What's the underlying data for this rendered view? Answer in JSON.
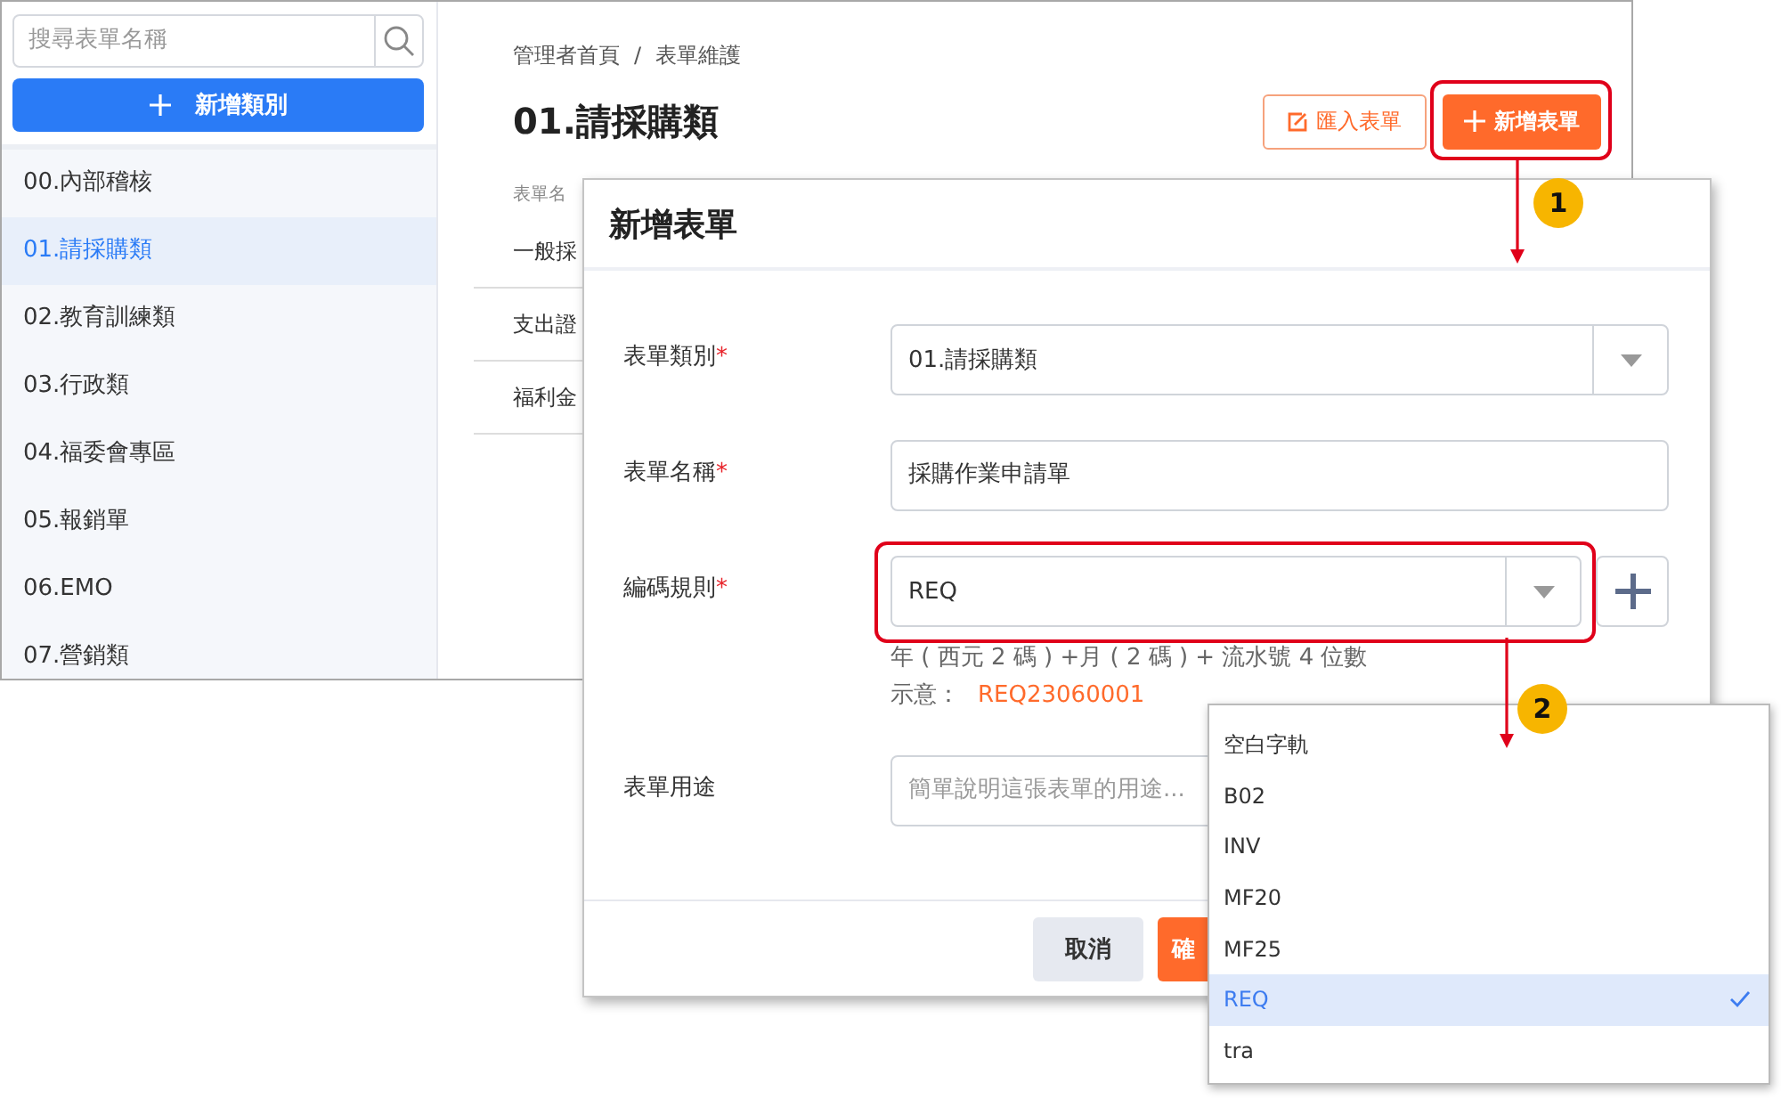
{
  "sidebar": {
    "search": {
      "placeholder": "搜尋表單名稱"
    },
    "add_button": "新增類別",
    "items": [
      {
        "label": "00.內部稽核",
        "selected": false
      },
      {
        "label": "01.請採購類",
        "selected": true
      },
      {
        "label": "02.教育訓練類",
        "selected": false
      },
      {
        "label": "03.行政類",
        "selected": false
      },
      {
        "label": "04.福委會專區",
        "selected": false
      },
      {
        "label": "05.報銷單",
        "selected": false
      },
      {
        "label": "06.EMO",
        "selected": false
      },
      {
        "label": "07.營銷類",
        "selected": false
      }
    ]
  },
  "breadcrumb": [
    "管理者首頁",
    "表單維護"
  ],
  "breadcrumb_separator": "/",
  "page_title": "01.請採購類",
  "actions": [
    {
      "label": "匯入表單",
      "kind": "outline"
    },
    {
      "label": "新增表單",
      "kind": "primary"
    }
  ],
  "table": {
    "columns": [
      "表單名"
    ],
    "rows": [
      "一般採",
      "支出證",
      "福利金"
    ]
  },
  "dialog": {
    "title": "新增表單",
    "required_mark": "*",
    "fields": [
      {
        "label": "表單類別",
        "required": true,
        "kind": "select",
        "value": "01.請採購類"
      },
      {
        "label": "表單名稱",
        "required": true,
        "kind": "text",
        "value": "採購作業申請單"
      },
      {
        "label": "編碼規則",
        "required": true,
        "kind": "select-add",
        "value": "REQ",
        "hint": "年 ( 西元 2 碼 ) +月 ( 2 碼 ) + 流水號 4 位數",
        "example_label": "示意：",
        "example": "REQ23060001"
      },
      {
        "label": "表單用途",
        "required": false,
        "kind": "textarea",
        "placeholder": "簡單說明這張表單的用途..."
      }
    ],
    "buttons": [
      {
        "label": "取消",
        "kind": "secondary"
      },
      {
        "label": "確",
        "kind": "primary"
      }
    ]
  },
  "dropdown": {
    "options": [
      {
        "label": "空白字軌",
        "selected": false
      },
      {
        "label": "B02",
        "selected": false
      },
      {
        "label": "INV",
        "selected": false
      },
      {
        "label": "MF20",
        "selected": false
      },
      {
        "label": "MF25",
        "selected": false
      },
      {
        "label": "REQ",
        "selected": true
      },
      {
        "label": "tra",
        "selected": false
      }
    ]
  },
  "callouts": [
    {
      "number": "1"
    },
    {
      "number": "2"
    }
  ]
}
